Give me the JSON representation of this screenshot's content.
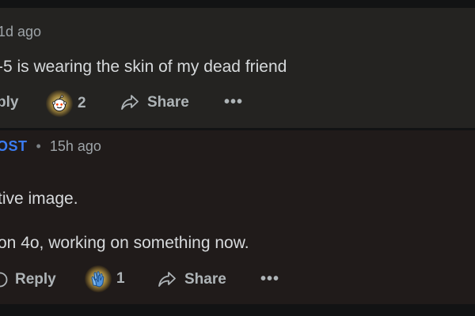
{
  "comments": [
    {
      "author": "",
      "time": "1d ago",
      "body": "-5 is wearing the skin of my dead friend",
      "actions": {
        "reply_label": "ply",
        "award_count": "2",
        "share_label": "Share",
        "more_label": "•••"
      },
      "award_icon": "reddit-snoo-award-icon"
    },
    {
      "author": "OST",
      "time": "15h ago",
      "separator": "•",
      "body_lines": [
        "tive image.",
        "on 4o, working on something now."
      ],
      "actions": {
        "reply_label": "Reply",
        "award_count": "1",
        "share_label": "Share",
        "more_label": "•••"
      },
      "award_icon": "clapping-hands-award-icon"
    }
  ],
  "colors": {
    "page_background": "#121314",
    "comment1_background": "#242321",
    "comment2_background": "#201b1a",
    "author_accent": "#3b7cf2",
    "text": "#d7dadc",
    "muted_text": "#9ea4a8"
  }
}
